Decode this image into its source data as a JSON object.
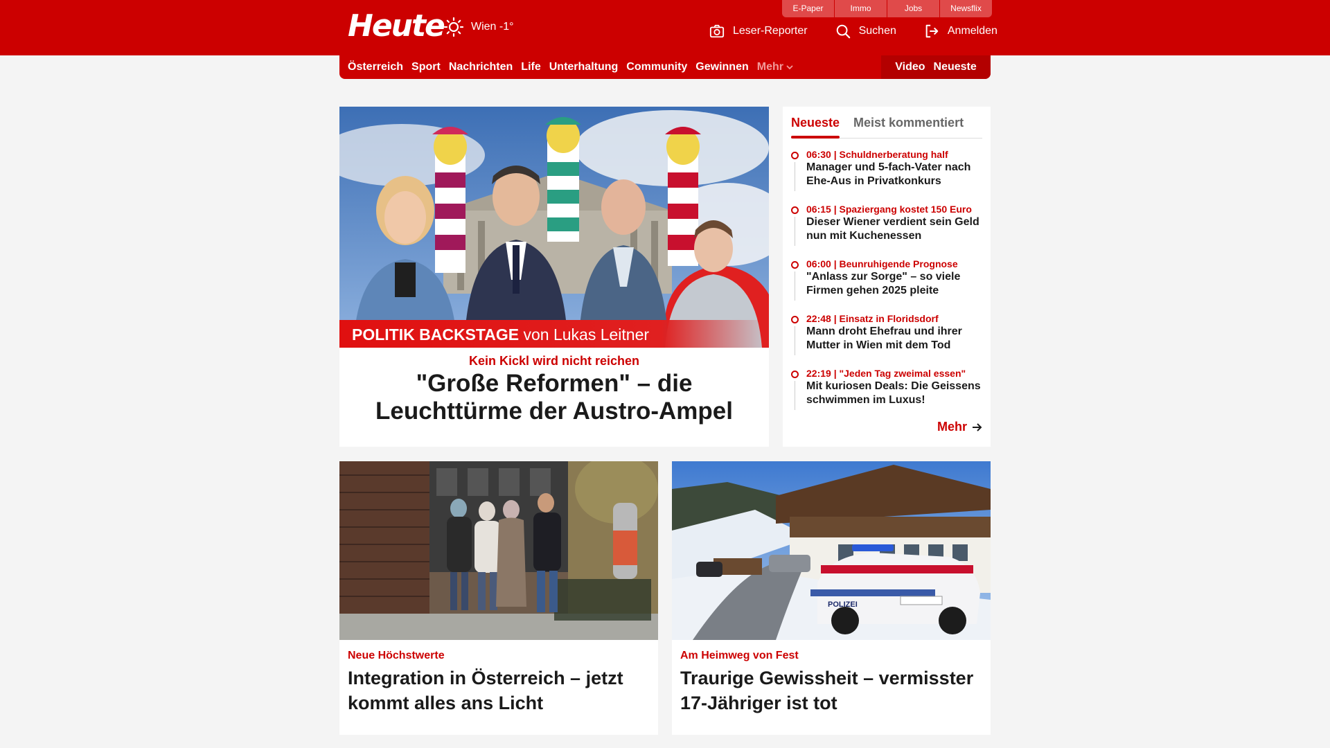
{
  "header": {
    "logo": "Heute",
    "weather": "Wien -1°",
    "top_links": [
      "E-Paper",
      "Immo",
      "Jobs",
      "Newsflix"
    ],
    "actions": {
      "reporter": "Leser-Reporter",
      "search": "Suchen",
      "login": "Anmelden"
    }
  },
  "nav": {
    "items": [
      "Österreich",
      "Sport",
      "Nachrichten",
      "Life",
      "Unterhaltung",
      "Community",
      "Gewinnen"
    ],
    "more": "Mehr",
    "video": "Video",
    "latest": "Neueste"
  },
  "hero": {
    "banner_bold": "POLITIK BACKSTAGE",
    "banner_rest": " von Lukas Leitner",
    "kicker": "Kein Kickl wird nicht reichen",
    "title": "\"Große Reformen\" – die Leuchttürme der Austro-Ampel"
  },
  "sidebar": {
    "tabs": [
      "Neueste",
      "Meist kommentiert"
    ],
    "items": [
      {
        "meta": "06:30 | Schuldnerberatung half",
        "title": "Manager und 5-fach-Vater nach Ehe-Aus in Privatkonkurs"
      },
      {
        "meta": "06:15 | Spaziergang kostet 150 Euro",
        "title": "Dieser Wiener verdient sein Geld nun mit Kuchenessen"
      },
      {
        "meta": "06:00 | Beunruhigende Prognose",
        "title": "\"Anlass zur Sorge\" – so viele Firmen gehen 2025 pleite"
      },
      {
        "meta": "22:48 | Einsatz in Floridsdorf",
        "title": "Mann droht Ehefrau und ihrer Mutter in Wien mit dem Tod"
      },
      {
        "meta": "22:19 | \"Jeden Tag zweimal essen\"",
        "title": "Mit kuriosen Deals: Die Geissens schwimmen im Luxus!"
      }
    ],
    "more": "Mehr"
  },
  "cards": [
    {
      "kicker": "Neue Höchstwerte",
      "title": "Integration in Österreich – jetzt kommt alles ans Licht"
    },
    {
      "kicker": "Am Heimweg von Fest",
      "title": "Traurige Gewissheit – vermisster 17-Jähriger ist tot"
    }
  ],
  "photo_texts": {
    "police_car": "POLIZEI"
  },
  "colors": {
    "brand_red": "#cc0000",
    "top_link_bg": "#e04a4a",
    "page_bg": "#f4f4f4"
  }
}
